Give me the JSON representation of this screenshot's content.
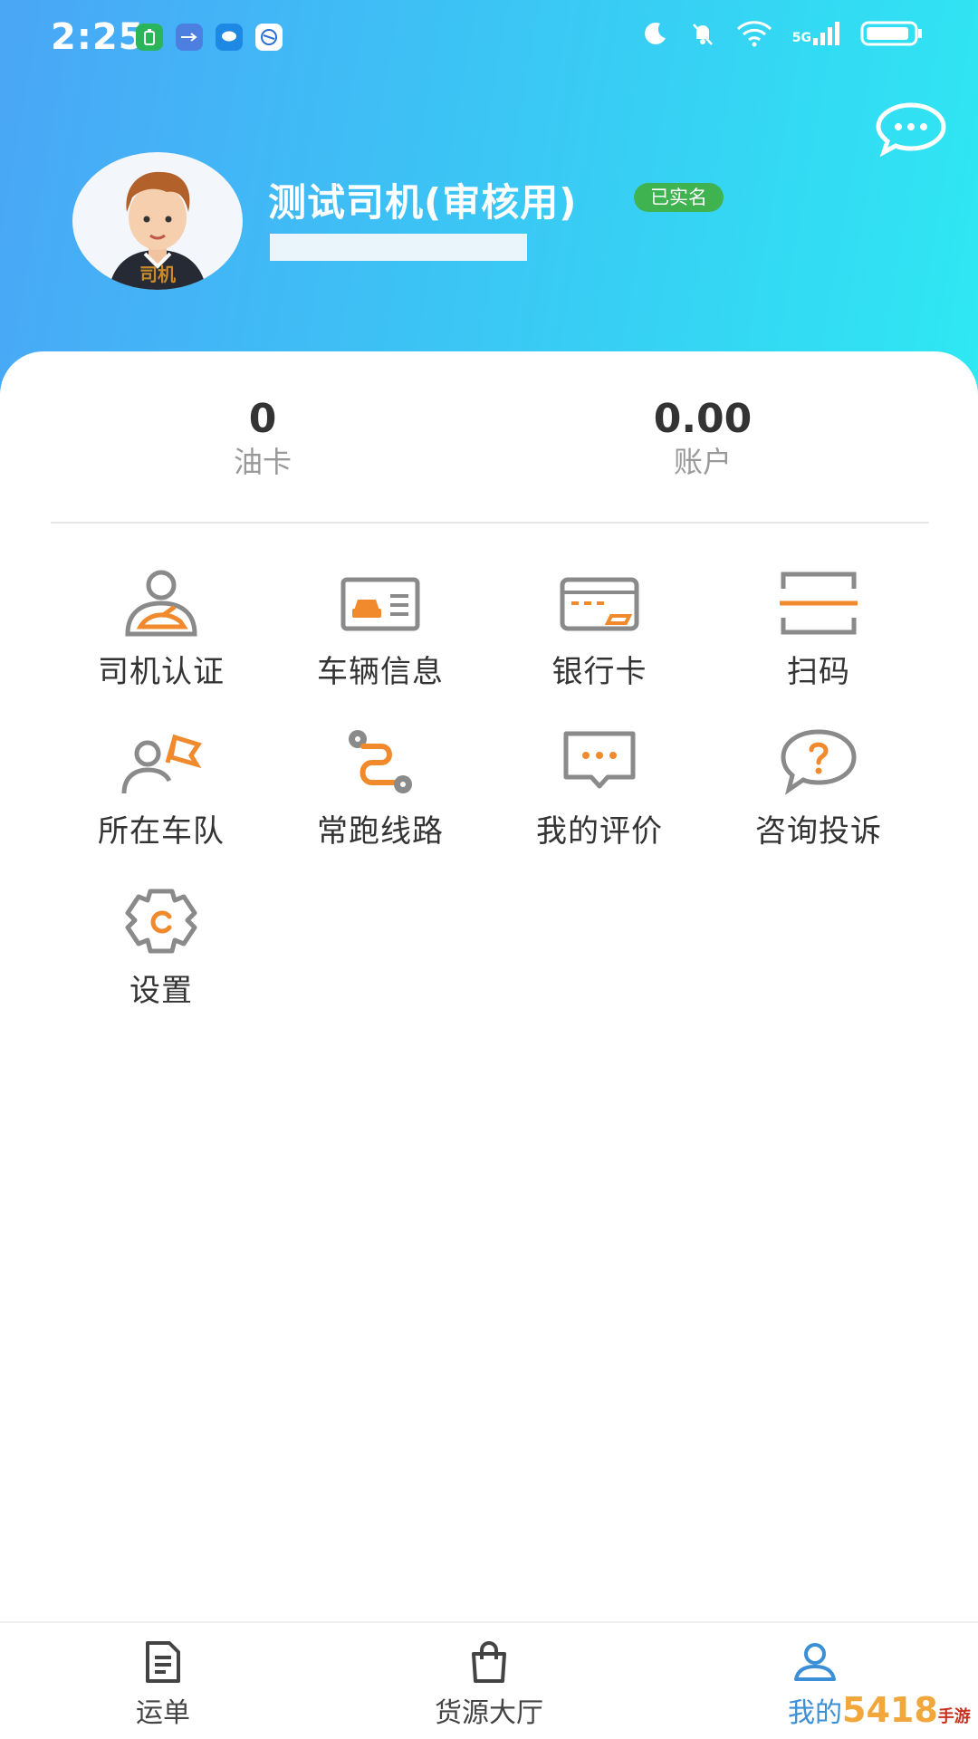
{
  "status_bar": {
    "time": "2:25",
    "network": "5G"
  },
  "header": {
    "message_icon": "chat-bubble-icon"
  },
  "profile": {
    "avatar_caption": "司机",
    "name": "测试司机(审核用)",
    "verified_badge": "已实名"
  },
  "stats": {
    "oil_card_value": "0",
    "oil_card_label": "油卡",
    "account_value": "0.00",
    "account_label": "账户"
  },
  "grid": {
    "items": [
      {
        "label": "司机认证",
        "icon": "driver-icon"
      },
      {
        "label": "车辆信息",
        "icon": "vehicle-card-icon"
      },
      {
        "label": "银行卡",
        "icon": "bank-card-icon"
      },
      {
        "label": "扫码",
        "icon": "scan-icon"
      },
      {
        "label": "所在车队",
        "icon": "fleet-flag-icon"
      },
      {
        "label": "常跑线路",
        "icon": "route-icon"
      },
      {
        "label": "我的评价",
        "icon": "review-icon"
      },
      {
        "label": "咨询投诉",
        "icon": "help-question-icon"
      },
      {
        "label": "设置",
        "icon": "settings-gear-icon"
      }
    ]
  },
  "bottom_nav": {
    "items": [
      {
        "label": "运单",
        "icon": "document-icon"
      },
      {
        "label": "货源大厅",
        "icon": "shopping-bag-icon"
      },
      {
        "label": "我的",
        "icon": "user-icon",
        "active": true
      }
    ]
  },
  "watermark": {
    "text": "5418",
    "sub": "手游网"
  },
  "colors": {
    "header_start": "#4aa6f6",
    "header_end": "#2ee8f2",
    "accent_orange": "#f08a2c",
    "icon_gray": "#8a8a8a",
    "badge_green": "#3fb34f",
    "active_blue": "#3b8fd6"
  }
}
